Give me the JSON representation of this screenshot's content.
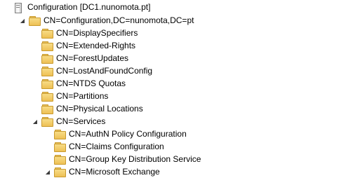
{
  "root": {
    "label": "Configuration [DC1.nunomota.pt]",
    "icon": "server-icon"
  },
  "nodes": [
    {
      "label": "CN=Configuration,DC=nunomota,DC=pt",
      "expanded": true
    },
    {
      "label": "CN=DisplaySpecifiers"
    },
    {
      "label": "CN=Extended-Rights"
    },
    {
      "label": "CN=ForestUpdates"
    },
    {
      "label": "CN=LostAndFoundConfig"
    },
    {
      "label": "CN=NTDS Quotas"
    },
    {
      "label": "CN=Partitions"
    },
    {
      "label": "CN=Physical Locations"
    },
    {
      "label": "CN=Services",
      "expanded": true
    },
    {
      "label": "CN=AuthN Policy Configuration"
    },
    {
      "label": "CN=Claims Configuration"
    },
    {
      "label": "CN=Group Key Distribution Service"
    },
    {
      "label": "CN=Microsoft Exchange",
      "expanded": true
    }
  ],
  "toggle_glyph": "◢"
}
